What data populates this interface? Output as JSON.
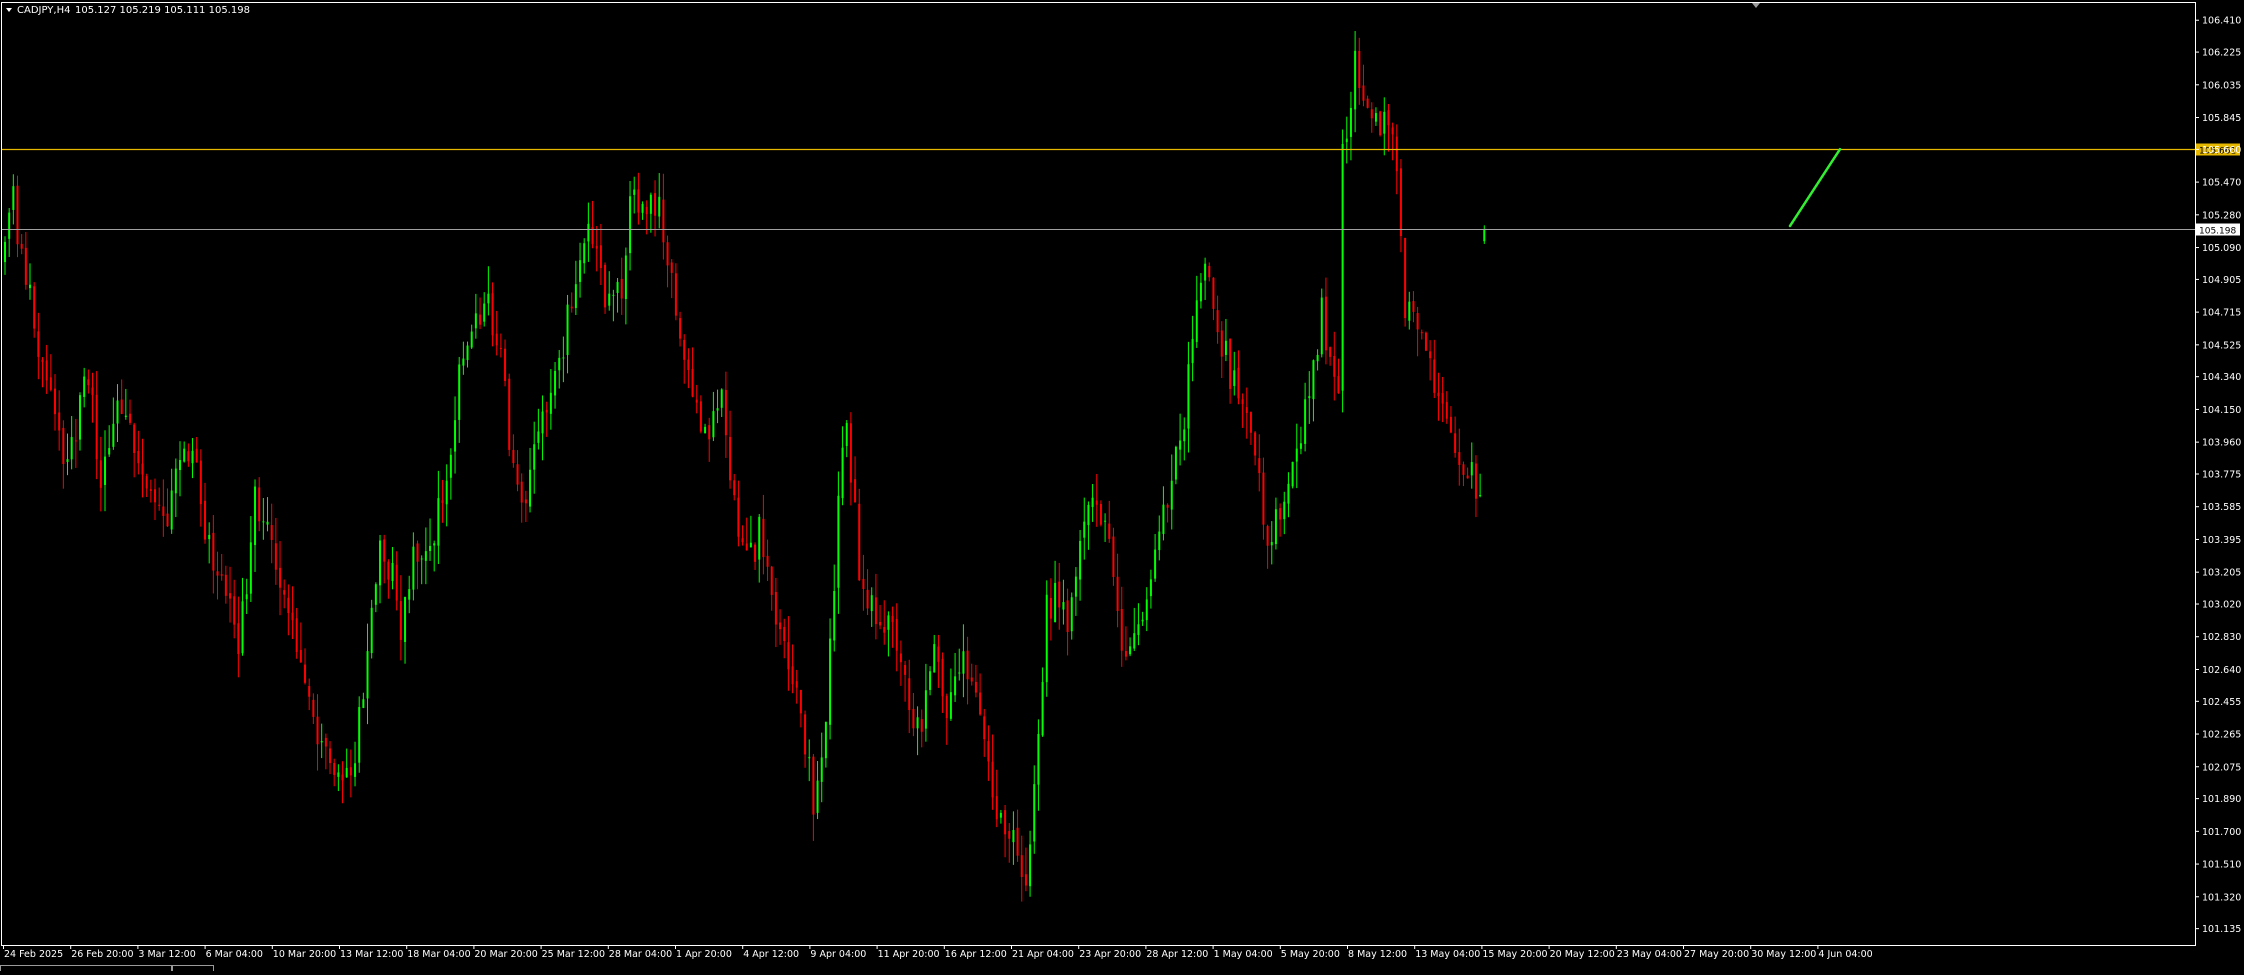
{
  "header": {
    "symbol_label": "CADJPY,H4",
    "ohlc_label": "105.127 105.219 105.111 105.198"
  },
  "chart_data": {
    "type": "candlestick",
    "symbol": "CADJPY",
    "timeframe": "H4",
    "ohlc": {
      "open": 105.127,
      "high": 105.219,
      "low": 105.111,
      "close": 105.198
    },
    "colors": {
      "bull": "#00ff00",
      "bear": "#ff0000",
      "level": "#e6b800",
      "bid": "#a0a0a0",
      "projection": "#33ee33",
      "axis": "#ffffff"
    },
    "ylim": [
      101.04,
      106.51
    ],
    "y_ticks": [
      "106.410",
      "106.225",
      "106.035",
      "105.845",
      "105.660",
      "105.470",
      "105.280",
      "105.090",
      "104.905",
      "104.715",
      "104.525",
      "104.340",
      "104.150",
      "103.960",
      "103.775",
      "103.585",
      "103.395",
      "103.205",
      "103.020",
      "102.830",
      "102.640",
      "102.455",
      "102.265",
      "102.075",
      "101.890",
      "101.700",
      "101.510",
      "101.320",
      "101.135"
    ],
    "x_ticks": [
      "24 Feb 2025",
      "26 Feb 20:00",
      "3 Mar 12:00",
      "6 Mar 04:00",
      "10 Mar 20:00",
      "13 Mar 12:00",
      "18 Mar 04:00",
      "20 Mar 20:00",
      "25 Mar 12:00",
      "28 Mar 04:00",
      "1 Apr 20:00",
      "4 Apr 12:00",
      "9 Apr 04:00",
      "11 Apr 20:00",
      "16 Apr 12:00",
      "21 Apr 04:00",
      "23 Apr 20:00",
      "28 Apr 12:00",
      "1 May 04:00",
      "5 May 20:00",
      "8 May 12:00",
      "13 May 04:00",
      "15 May 20:00",
      "20 May 12:00",
      "23 May 04:00",
      "27 May 20:00",
      "30 May 12:00",
      "4 Jun 04:00"
    ],
    "bar_count": 356,
    "anchors": [
      [
        0,
        105.05
      ],
      [
        2,
        105.35
      ],
      [
        5,
        104.9
      ],
      [
        10,
        104.25
      ],
      [
        15,
        103.85
      ],
      [
        20,
        104.4
      ],
      [
        23,
        103.7
      ],
      [
        26,
        104.15
      ],
      [
        32,
        103.9
      ],
      [
        33,
        103.75
      ],
      [
        38,
        103.45
      ],
      [
        40,
        103.7
      ],
      [
        45,
        104.0
      ],
      [
        48,
        103.4
      ],
      [
        53,
        103.05
      ],
      [
        56,
        102.75
      ],
      [
        60,
        103.6
      ],
      [
        64,
        103.4
      ],
      [
        69,
        102.9
      ],
      [
        75,
        102.3
      ],
      [
        78,
        102.15
      ],
      [
        83,
        102.0
      ],
      [
        88,
        102.95
      ],
      [
        90,
        103.3
      ],
      [
        93,
        103.15
      ],
      [
        95,
        102.75
      ],
      [
        98,
        103.4
      ],
      [
        102,
        103.3
      ],
      [
        106,
        103.8
      ],
      [
        110,
        104.55
      ],
      [
        115,
        104.8
      ],
      [
        119,
        104.45
      ],
      [
        122,
        103.8
      ],
      [
        125,
        103.6
      ],
      [
        130,
        104.2
      ],
      [
        134,
        104.55
      ],
      [
        137,
        104.9
      ],
      [
        140,
        105.2
      ],
      [
        141,
        105.15
      ],
      [
        144,
        104.75
      ],
      [
        148,
        104.9
      ],
      [
        150,
        105.3
      ],
      [
        153,
        105.4
      ],
      [
        157,
        105.35
      ],
      [
        162,
        104.6
      ],
      [
        166,
        104.15
      ],
      [
        169,
        103.95
      ],
      [
        172,
        104.3
      ],
      [
        175,
        103.55
      ],
      [
        180,
        103.3
      ],
      [
        181,
        103.6
      ],
      [
        183,
        103.2
      ],
      [
        186,
        102.8
      ],
      [
        190,
        102.55
      ],
      [
        194,
        101.85
      ],
      [
        197,
        102.4
      ],
      [
        200,
        103.6
      ],
      [
        202,
        104.1
      ],
      [
        205,
        103.2
      ],
      [
        210,
        102.9
      ],
      [
        213,
        102.95
      ],
      [
        216,
        102.55
      ],
      [
        220,
        102.2
      ],
      [
        223,
        102.85
      ],
      [
        226,
        102.45
      ],
      [
        230,
        102.75
      ],
      [
        236,
        102.1
      ],
      [
        237,
        101.9
      ],
      [
        239,
        101.8
      ],
      [
        243,
        101.55
      ],
      [
        245,
        101.45
      ],
      [
        248,
        102.3
      ],
      [
        250,
        103.0
      ],
      [
        253,
        103.1
      ],
      [
        255,
        102.9
      ],
      [
        258,
        103.45
      ],
      [
        262,
        103.6
      ],
      [
        265,
        103.3
      ],
      [
        268,
        102.8
      ],
      [
        270,
        102.75
      ],
      [
        274,
        103.1
      ],
      [
        279,
        103.6
      ],
      [
        283,
        104.1
      ],
      [
        286,
        104.8
      ],
      [
        288,
        105.0
      ],
      [
        291,
        104.65
      ],
      [
        294,
        104.35
      ],
      [
        297,
        104.2
      ],
      [
        300,
        103.9
      ],
      [
        303,
        103.4
      ],
      [
        308,
        103.75
      ],
      [
        313,
        104.2
      ],
      [
        316,
        104.75
      ],
      [
        318,
        104.45
      ],
      [
        320,
        104.3
      ],
      [
        321,
        105.6
      ],
      [
        323,
        106.0
      ],
      [
        324,
        106.15
      ],
      [
        325,
        106.1
      ],
      [
        327,
        105.8
      ],
      [
        330,
        105.85
      ],
      [
        333,
        105.75
      ],
      [
        334,
        105.45
      ],
      [
        336,
        104.7
      ],
      [
        339,
        104.6
      ],
      [
        342,
        104.35
      ],
      [
        346,
        104.2
      ],
      [
        348,
        103.95
      ],
      [
        352,
        103.75
      ],
      [
        356,
        103.6
      ],
      [
        360,
        103.6
      ],
      [
        363,
        103.7
      ],
      [
        366,
        103.9
      ],
      [
        369,
        103.95
      ],
      [
        373,
        103.75
      ],
      [
        377,
        103.95
      ],
      [
        380,
        104.2
      ],
      [
        384,
        104.65
      ],
      [
        388,
        104.55
      ],
      [
        391,
        104.85
      ],
      [
        393,
        105.2
      ],
      [
        396,
        104.85
      ],
      [
        398,
        104.55
      ],
      [
        401,
        104.2
      ],
      [
        404,
        104.65
      ],
      [
        406,
        104.3
      ],
      [
        409,
        104.1
      ],
      [
        411,
        104.55
      ],
      [
        414,
        104.9
      ],
      [
        415,
        105.0
      ],
      [
        418,
        104.85
      ],
      [
        419,
        104.55
      ],
      [
        422,
        104.75
      ],
      [
        424,
        105.05
      ],
      [
        426,
        105.2
      ],
      [
        428,
        105.198
      ]
    ],
    "levels": [
      {
        "kind": "resistance",
        "price": 105.661,
        "label": "105.661"
      },
      {
        "kind": "bid",
        "price": 105.198,
        "label": "105.198"
      }
    ],
    "projection": {
      "from_price": 105.198,
      "to_price": 105.661
    }
  }
}
